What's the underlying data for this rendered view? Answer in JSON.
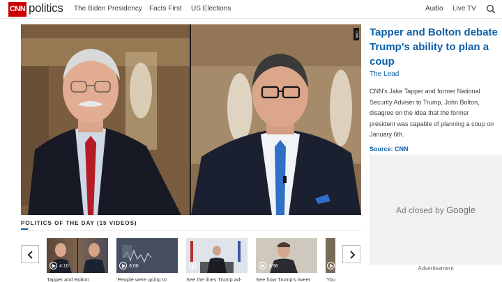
{
  "header": {
    "logo": "CNN",
    "section": "politics",
    "nav": [
      "The Biden Presidency",
      "Facts First",
      "US Elections"
    ],
    "right_nav": [
      "Audio",
      "Live TV"
    ],
    "search_icon": "search-icon"
  },
  "video": {
    "bug": "CNN"
  },
  "article": {
    "title": "Tapper and Bolton debate Trump's ability to plan a coup",
    "show": "The Lead",
    "description": "CNN's Jake Tapper and former National Security Adviser to Trump, John Bolton, disagree on the idea that the former president was capable of planning a coup on January 6th.",
    "source": "Source: CNN"
  },
  "ad": {
    "closed_prefix": "Ad closed by ",
    "closed_brand": "Google",
    "label": "Advertisement"
  },
  "strip": {
    "title": "POLITICS OF THE DAY (15 VIDEOS)",
    "prev_icon": "chevron-left-icon",
    "next_icon": "chevron-right-icon",
    "thumbs": [
      {
        "duration": "4:10",
        "caption": "Tapper and Bolton"
      },
      {
        "duration": "3:06",
        "caption": "'People were going to"
      },
      {
        "duration": "",
        "caption": "See the lines Trump ad-"
      },
      {
        "duration": "3:56",
        "caption": "See how Trump's tweet"
      },
      {
        "duration": "",
        "caption": "'You"
      }
    ]
  },
  "colors": {
    "brand_red": "#cc0000",
    "link_blue": "#0c5fa8"
  }
}
